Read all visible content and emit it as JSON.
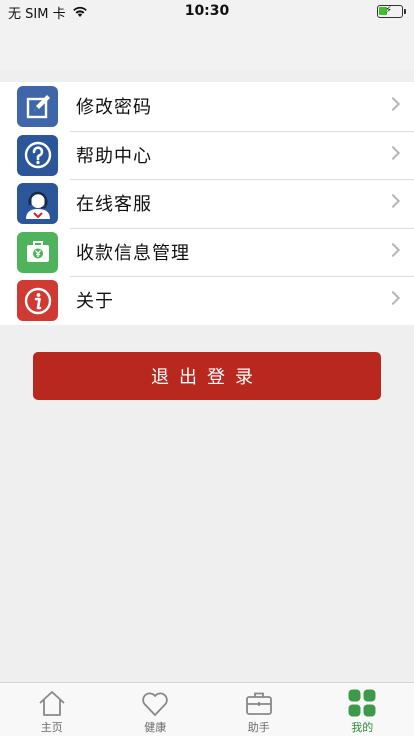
{
  "status_bar": {
    "carrier": "无 SIM 卡",
    "time": "10:30"
  },
  "menu": [
    {
      "label": "修改密码",
      "icon": "edit-password-icon",
      "color": "#3f66a8"
    },
    {
      "label": "帮助中心",
      "icon": "help-icon",
      "color": "#2b579a"
    },
    {
      "label": "在线客服",
      "icon": "customer-service-icon",
      "color": "#2b579a"
    },
    {
      "label": "收款信息管理",
      "icon": "wallet-icon",
      "color": "#4fb35c"
    },
    {
      "label": "关于",
      "icon": "info-icon",
      "color": "#cf3a32"
    }
  ],
  "logout_label": "退出登录",
  "tabs": [
    {
      "label": "主页",
      "icon": "home-icon",
      "active": false
    },
    {
      "label": "健康",
      "icon": "heart-icon",
      "active": false
    },
    {
      "label": "助手",
      "icon": "briefcase-icon",
      "active": false
    },
    {
      "label": "我的",
      "icon": "grid-icon",
      "active": true
    }
  ],
  "colors": {
    "accent_red": "#b8281f",
    "active_tab_green": "#2e8b3a"
  }
}
